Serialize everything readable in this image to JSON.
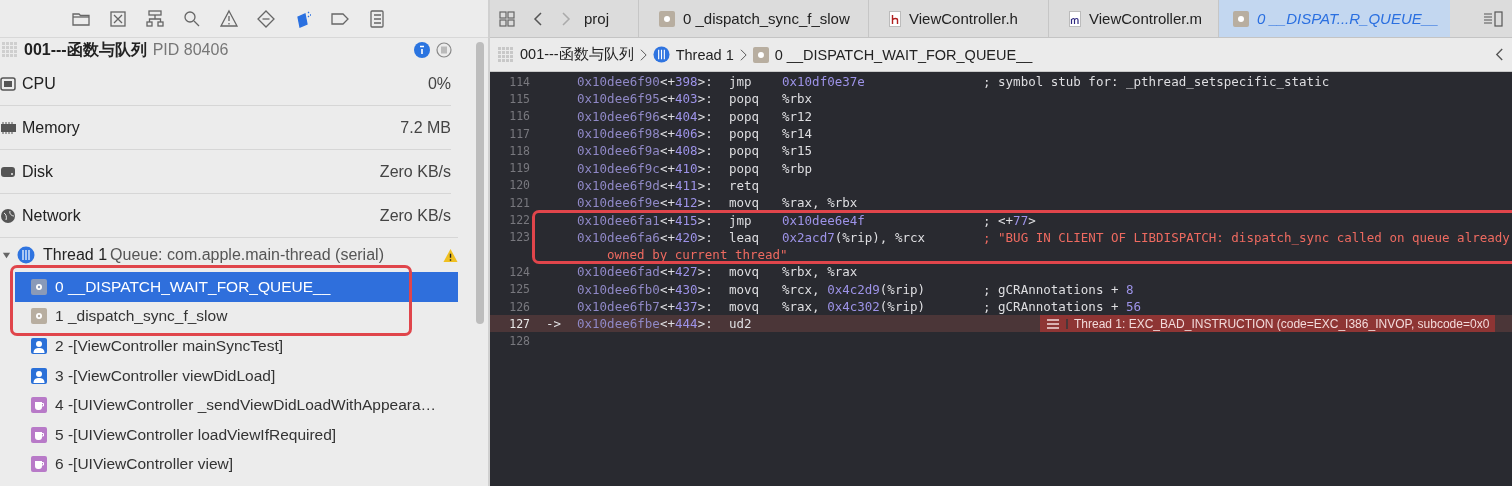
{
  "navigator": [
    {
      "selected": false
    },
    {
      "selected": false
    },
    {
      "selected": false
    },
    {
      "selected": false
    },
    {
      "selected": false
    },
    {
      "selected": false
    },
    {
      "selected": true
    },
    {
      "selected": false
    },
    {
      "selected": false
    }
  ],
  "process": {
    "name": "001---函数与队列",
    "pid": "PID 80406"
  },
  "gauges": [
    {
      "label": "CPU",
      "value": "0%"
    },
    {
      "label": "Memory",
      "value": "7.2 MB"
    },
    {
      "label": "Disk",
      "value": "Zero KB/s"
    },
    {
      "label": "Network",
      "value": "Zero KB/s"
    }
  ],
  "thread": {
    "name": "Thread 1",
    "queue": "Queue: com.apple.main-thread (serial)",
    "expanded": true,
    "warning": true
  },
  "frames": [
    {
      "label": "0 __DISPATCH_WAIT_FOR_QUEUE__",
      "kind": "system",
      "selected": true
    },
    {
      "label": "1 _dispatch_sync_f_slow",
      "kind": "system",
      "selected": false
    },
    {
      "label": "2 -[ViewController mainSyncTest]",
      "kind": "user",
      "selected": false
    },
    {
      "label": "3 -[ViewController viewDidLoad]",
      "kind": "user",
      "selected": false
    },
    {
      "label": "4 -[UIViewController _sendViewDidLoadWithAppeara…",
      "kind": "framework",
      "selected": false
    },
    {
      "label": "5 -[UIViewController loadViewIfRequired]",
      "kind": "framework",
      "selected": false
    },
    {
      "label": "6 -[UIViewController view]",
      "kind": "framework",
      "selected": false
    }
  ],
  "tabs": [
    {
      "label": "proj",
      "selected": false
    },
    {
      "label": "0 _dispatch_sync_f_slow",
      "selected": false
    },
    {
      "label": "ViewController.h",
      "selected": false
    },
    {
      "label": "ViewController.m",
      "selected": false
    },
    {
      "label": "0 __DISPAT...R_QUEUE__",
      "selected": true
    }
  ],
  "breadcrumb": [
    {
      "label": "001---函数与队列"
    },
    {
      "label": "Thread 1"
    },
    {
      "label": "0 __DISPATCH_WAIT_FOR_QUEUE__"
    }
  ],
  "lines": [
    {
      "number": "114",
      "address": "0x10dee6f90",
      "offset": "<+398>:",
      "op": "jmp",
      "args": "0x10df0e37e",
      "comment": "; symbol stub for: _pthread_setspecific_static",
      "kind": "plain",
      "current": false
    },
    {
      "number": "115",
      "address": "0x10dee6f95",
      "offset": "<+403>:",
      "op": "popq",
      "args": "%rbx",
      "current": false
    },
    {
      "number": "116",
      "address": "0x10dee6f96",
      "offset": "<+404>:",
      "op": "popq",
      "args": "%r12",
      "current": false
    },
    {
      "number": "117",
      "address": "0x10dee6f98",
      "offset": "<+406>:",
      "op": "popq",
      "args": "%r14",
      "current": false
    },
    {
      "number": "118",
      "address": "0x10dee6f9a",
      "offset": "<+408>:",
      "op": "popq",
      "args": "%r15",
      "current": false
    },
    {
      "number": "119",
      "address": "0x10dee6f9c",
      "offset": "<+410>:",
      "op": "popq",
      "args": "%rbp",
      "current": false
    },
    {
      "number": "120",
      "address": "0x10dee6f9d",
      "offset": "<+411>:",
      "op": "retq",
      "current": false
    },
    {
      "number": "121",
      "address": "0x10dee6f9e",
      "offset": "<+412>:",
      "op": "movq",
      "args": "%rax, %rbx",
      "current": false
    },
    {
      "number": "122",
      "address": "0x10dee6fa1",
      "offset": "<+415>:",
      "op": "jmp",
      "args": "0x10dee6e4f",
      "comment": "; <+77>",
      "kind": "plain",
      "current": false
    },
    {
      "number": "123",
      "address": "0x10dee6fa6",
      "offset": "<+420>:",
      "op": "leaq",
      "args": "0x2acd7(%rip), %rcx",
      "comment": "; \"BUG IN CLIENT OF LIBDISPATCH: dispatch_sync called on queue already",
      "kind": "string",
      "continuation": "owned by current thread\"",
      "current": false
    },
    {
      "number": "124",
      "address": "0x10dee6fad",
      "offset": "<+427>:",
      "op": "movq",
      "args": "%rbx, %rax",
      "current": false
    },
    {
      "number": "125",
      "address": "0x10dee6fb0",
      "offset": "<+430>:",
      "op": "movq",
      "args": "%rcx, 0x4c2d9(%rip)",
      "comment": "; gCRAnnotations + 8",
      "kind": "plain",
      "current": false
    },
    {
      "number": "126",
      "address": "0x10dee6fb7",
      "offset": "<+437>:",
      "op": "movq",
      "args": "%rax, 0x4c302(%rip)",
      "comment": "; gCRAnnotations + 56",
      "kind": "plain",
      "current": false
    },
    {
      "number": "127",
      "marker": "->",
      "address": "0x10dee6fbe",
      "offset": "<+444>:",
      "op": "ud2",
      "current": true,
      "error": "Thread 1: EXC_BAD_INSTRUCTION (code=EXC_I386_INVOP, subcode=0x0"
    },
    {
      "number": "128",
      "current": false
    }
  ]
}
